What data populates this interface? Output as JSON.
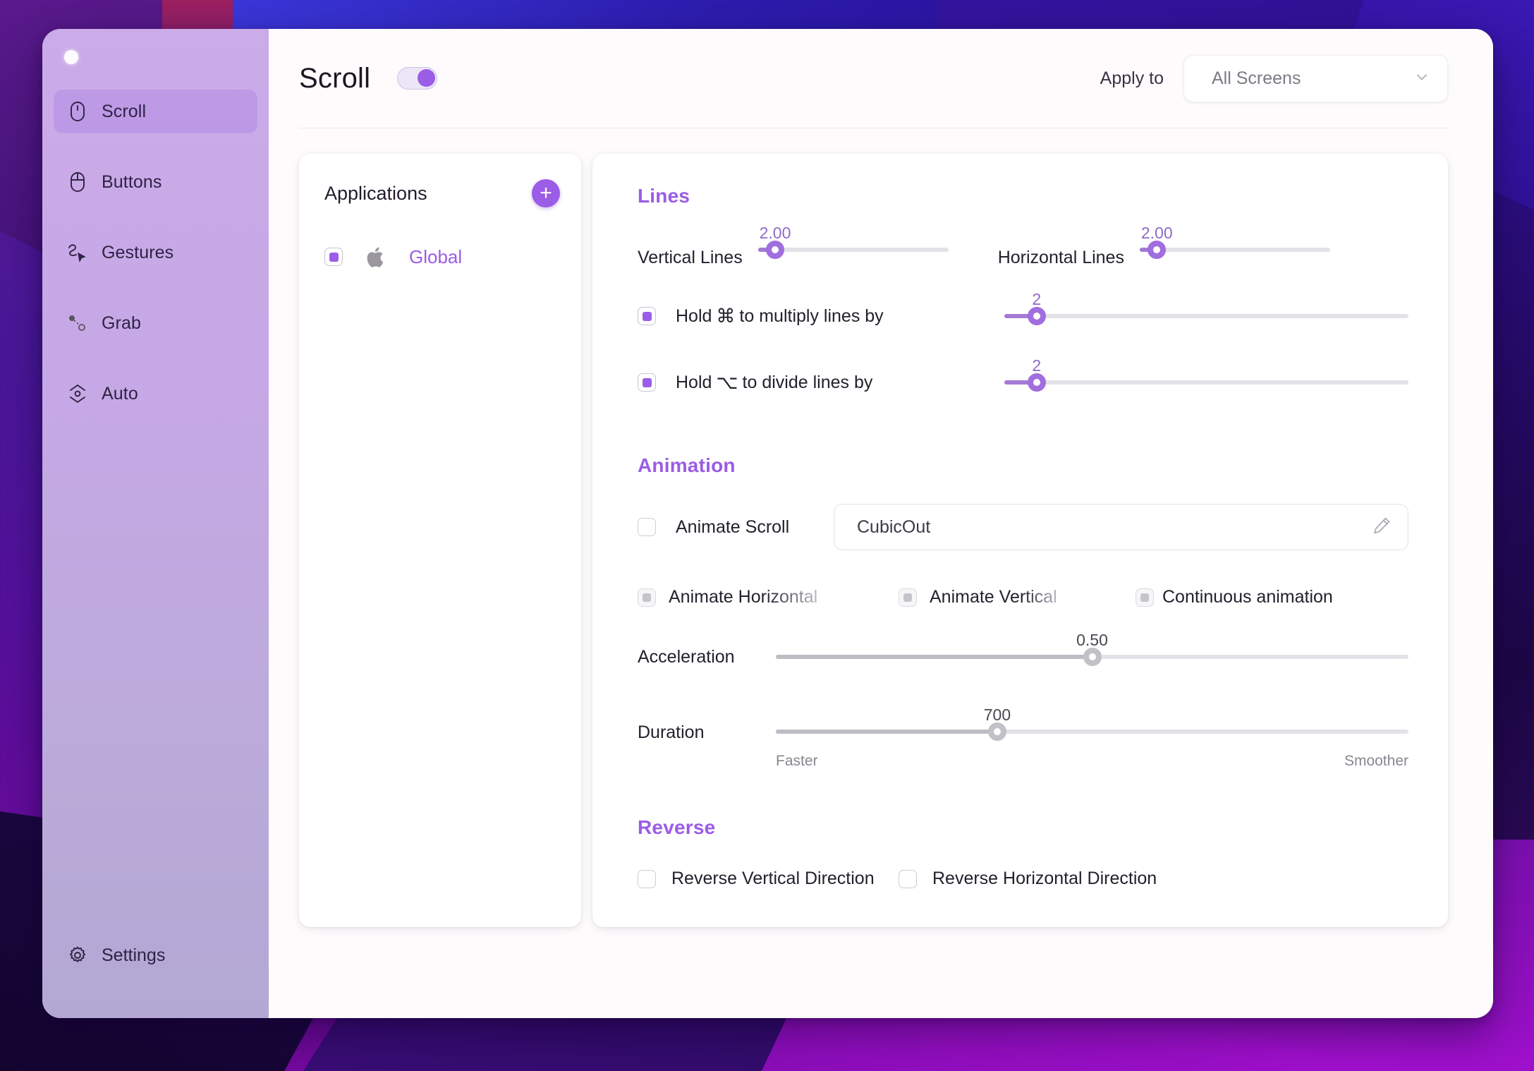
{
  "window": {
    "title": "Scroll",
    "traffic_light": "close-dot"
  },
  "sidebar": {
    "items": [
      {
        "label": "Scroll",
        "icon": "mouse-scroll-icon",
        "active": true
      },
      {
        "label": "Buttons",
        "icon": "mouse-buttons-icon",
        "active": false
      },
      {
        "label": "Gestures",
        "icon": "gesture-cursor-icon",
        "active": false
      },
      {
        "label": "Grab",
        "icon": "grab-drag-icon",
        "active": false
      },
      {
        "label": "Auto",
        "icon": "auto-layers-icon",
        "active": false
      }
    ],
    "settings": {
      "label": "Settings",
      "icon": "gear-icon"
    }
  },
  "header": {
    "title": "Scroll",
    "enabled_toggle": {
      "name": "scroll-enabled-toggle",
      "state": "on"
    },
    "apply_to_label": "Apply to",
    "apply_to_value": "All Screens",
    "apply_to_chevron": "chevron-down-icon"
  },
  "applications": {
    "title": "Applications",
    "add_button": "+",
    "items": [
      {
        "name": "Global",
        "checked": true,
        "icon": "apple-logo-icon"
      }
    ]
  },
  "lines": {
    "section": "Lines",
    "vertical": {
      "label": "Vertical Lines",
      "value": "2.00",
      "pct": 9
    },
    "horizontal": {
      "label": "Horizontal Lines",
      "value": "2.00",
      "pct": 9
    },
    "multiply": {
      "checked": true,
      "text_before": "Hold",
      "key": "⌘",
      "text_after": "to multiply lines by",
      "value": "2",
      "pct": 8
    },
    "divide": {
      "checked": true,
      "text_before": "Hold",
      "key": "⌥",
      "text_after": "to divide lines by",
      "value": "2",
      "pct": 8
    }
  },
  "animation": {
    "section": "Animation",
    "animate_scroll": {
      "label": "Animate Scroll",
      "checked": false
    },
    "easing": {
      "value": "CubicOut",
      "edit_icon": "pencil-icon"
    },
    "animate_horizontal": {
      "label": "Animate Horizontal",
      "checked": true,
      "disabled": true
    },
    "animate_vertical": {
      "label": "Animate Vertical",
      "checked": true,
      "disabled": true
    },
    "continuous": {
      "label": "Continuous animation",
      "checked": true,
      "disabled": true
    },
    "acceleration": {
      "label": "Acceleration",
      "value": "0.50",
      "pct": 50
    },
    "duration": {
      "label": "Duration",
      "value": "700",
      "pct": 35,
      "min_label": "Faster",
      "max_label": "Smoother"
    }
  },
  "reverse": {
    "section": "Reverse",
    "vertical": {
      "label": "Reverse Vertical Direction",
      "checked": false
    },
    "horizontal": {
      "label": "Reverse Horizontal Direction",
      "checked": false
    }
  },
  "colors": {
    "accent": "#9b5ce6",
    "accent_muted": "#a47ad4",
    "sidebar_top": "#cbabe8",
    "sidebar_bottom": "#b3a8d4",
    "text": "#24202c",
    "muted": "#8a8690"
  }
}
